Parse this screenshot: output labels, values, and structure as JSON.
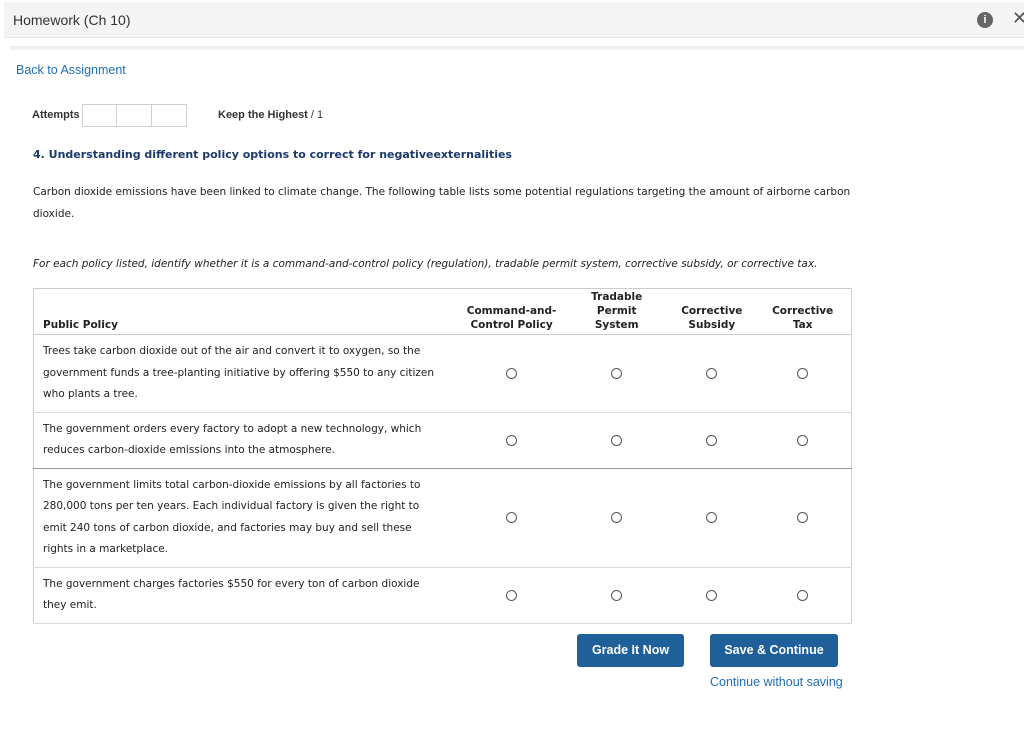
{
  "header": {
    "title": "Homework (Ch 10)",
    "info_icon": "info-icon",
    "close_icon": "close-icon"
  },
  "nav": {
    "back_link": "Back to Assignment"
  },
  "attempts": {
    "label": "Attempts",
    "keep_label": "Keep the Highest",
    "suffix": "/ 1"
  },
  "question": {
    "title": "4. Understanding different policy options to correct for negativeexternalities",
    "intro": "Carbon dioxide emissions have been linked to climate change. The following table lists some potential regulations targeting the amount of airborne carbon dioxide.",
    "instruction": "For each policy listed, identify whether it is a command-and-control policy (regulation), tradable permit system, corrective subsidy, or corrective tax."
  },
  "table": {
    "headers": {
      "policy": "Public Policy",
      "col1": "Command-and-Control Policy",
      "col2": "Tradable Permit System",
      "col3": "Corrective Subsidy",
      "col4": "Corrective Tax"
    },
    "rows": [
      {
        "text": "Trees take carbon dioxide out of the air and convert it to oxygen, so the government funds a tree-planting initiative by offering $550 to any citizen who plants a tree."
      },
      {
        "text": "The government orders every factory to adopt a new technology, which reduces carbon-dioxide emissions into the atmosphere."
      },
      {
        "text": "The government limits total carbon-dioxide emissions by all factories to 280,000 tons per ten years. Each individual factory is given the right to emit 240 tons of carbon dioxide, and factories may buy and sell these rights in a marketplace."
      },
      {
        "text": "The government charges factories $550 for every ton of carbon dioxide they emit."
      }
    ]
  },
  "actions": {
    "grade_button": "Grade It Now",
    "save_button": "Save & Continue",
    "continue_link": "Continue without saving"
  }
}
